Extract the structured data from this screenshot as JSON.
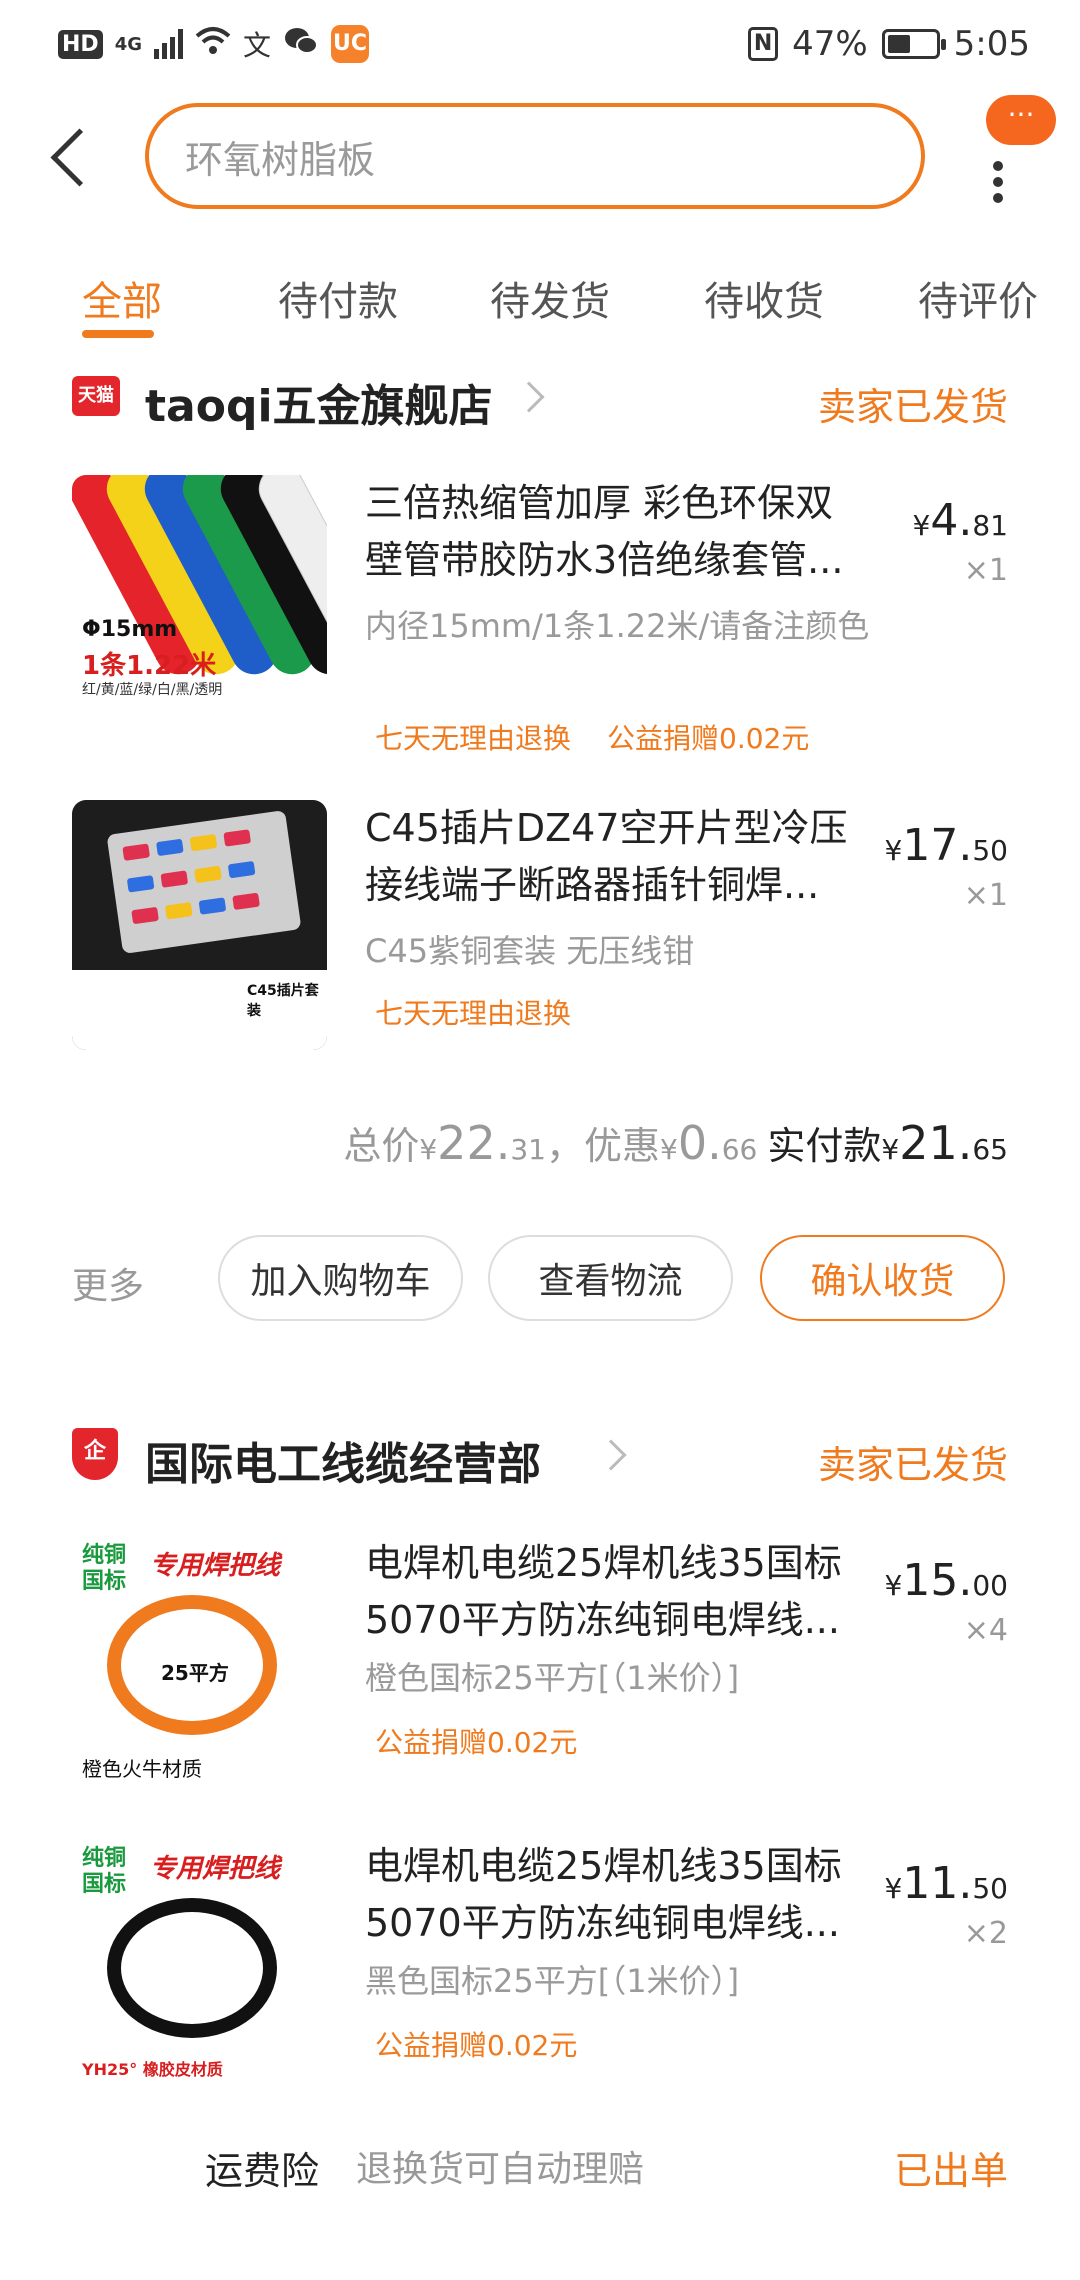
{
  "status_bar": {
    "hd": "HD",
    "network": "4G",
    "battery_percent_text": "47%",
    "battery_level": 0.47,
    "time": "5:05",
    "nfc": "N"
  },
  "header": {
    "search_placeholder": "环氧树脂板",
    "more_badge": "···"
  },
  "tabs": [
    "全部",
    "待付款",
    "待发货",
    "待收货",
    "待评价"
  ],
  "orders": [
    {
      "shop_badge": "天猫",
      "shop_name": "taoqi五金旗舰店",
      "status": "卖家已发货",
      "items": [
        {
          "title": "三倍热缩管加厚 彩色环保双壁管带胶防水3倍绝缘套管...",
          "spec": "内径15mm/1条1.22米/请备注颜色",
          "tags": [
            "七天无理由退换",
            "公益捐赠0.02元"
          ],
          "price_symbol": "¥",
          "price_int": "4.",
          "price_dec": "81",
          "qty": "×1",
          "thumb_text": {
            "size": "Φ15mm",
            "length": "1条1.22米",
            "colors": "红/黄/蓝/绿/白/黑/透明"
          }
        },
        {
          "title": "C45插片DZ47空开片型冷压接线端子断路器插针铜焊...",
          "spec": "C45紫铜套装 无压线钳",
          "tags": [
            "七天无理由退换"
          ],
          "price_symbol": "¥",
          "price_int": "17.",
          "price_dec": "50",
          "qty": "×1",
          "thumb_text": {
            "label": "C45插片套装"
          }
        }
      ],
      "summary": {
        "total_label": "总价",
        "total_sym": "¥",
        "total_int": "22.",
        "total_dec": "31",
        "sep": "，",
        "discount_label": "优惠",
        "discount_sym": "¥",
        "discount_int": "0.",
        "discount_dec": "66",
        "paid_label": "实付款",
        "paid_sym": "¥",
        "paid_int": "21.",
        "paid_dec": "65"
      },
      "actions": {
        "more": "更多",
        "add_cart": "加入购物车",
        "view_logistics": "查看物流",
        "confirm": "确认收货"
      }
    },
    {
      "shop_badge": "企",
      "shop_name": "国际电工线缆经营部",
      "status": "卖家已发货",
      "items": [
        {
          "title": "电焊机电缆25焊机线35国标5070平方防冻纯铜电焊线...",
          "spec": "橙色国标25平方[（1米价）]",
          "tags": [
            "公益捐赠0.02元"
          ],
          "price_symbol": "¥",
          "price_int": "15.",
          "price_dec": "00",
          "qty": "×4",
          "thumb_text": {
            "l1": "纯铜\n国标",
            "l2": "专用焊把线",
            "l3": "25平方",
            "l4": "橙色火牛材质"
          }
        },
        {
          "title": "电焊机电缆25焊机线35国标5070平方防冻纯铜电焊线...",
          "spec": "黑色国标25平方[（1米价）]",
          "tags": [
            "公益捐赠0.02元"
          ],
          "price_symbol": "¥",
          "price_int": "11.",
          "price_dec": "50",
          "qty": "×2",
          "thumb_text": {
            "l1": "纯铜\n国标",
            "l2": "专用焊把线",
            "l4": "YH25° 橡胶皮材质"
          }
        }
      ]
    }
  ],
  "footer": {
    "label": "运费险",
    "desc": "退换货可自动理赔",
    "status": "已出单"
  },
  "colors": {
    "accent": "#f07a1e",
    "tmall_red": "#e3262c"
  }
}
